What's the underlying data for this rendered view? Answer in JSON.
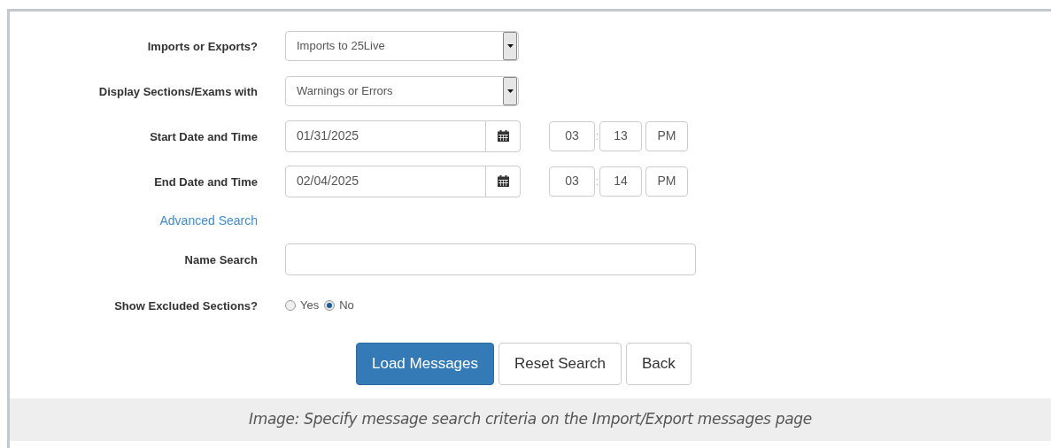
{
  "form": {
    "rows": [
      {
        "kind": "select",
        "label": "Imports or Exports?",
        "value": "Imports to 25Live"
      },
      {
        "kind": "select",
        "label": "Display Sections/Exams with",
        "value": "Warnings or Errors"
      },
      {
        "kind": "datetime",
        "label": "Start Date and Time",
        "date": "01/31/2025",
        "hour": "03",
        "separator": ":",
        "minute": "13",
        "period": "PM"
      },
      {
        "kind": "datetime",
        "label": "End Date and Time",
        "date": "02/04/2025",
        "hour": "03",
        "separator": ":",
        "minute": "14",
        "period": "PM"
      },
      {
        "kind": "link",
        "label": "Advanced Search"
      },
      {
        "kind": "text",
        "label": "Name Search"
      },
      {
        "kind": "radio",
        "label": "Show Excluded Sections?",
        "options": [
          {
            "label": "Yes",
            "selected": false
          },
          {
            "label": "No",
            "selected": true
          }
        ]
      }
    ]
  },
  "buttons": [
    {
      "label": "Load Messages",
      "primary": true
    },
    {
      "label": "Reset Search",
      "primary": false
    },
    {
      "label": "Back",
      "primary": false
    }
  ],
  "caption": "Image: Specify message search criteria on the Import/Export messages page"
}
